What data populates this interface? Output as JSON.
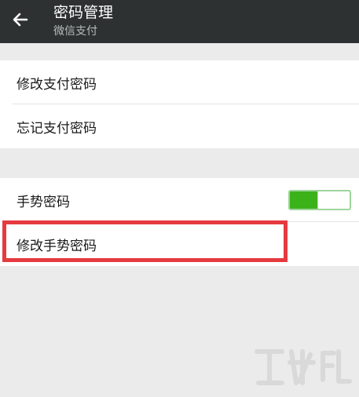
{
  "header": {
    "title": "密码管理",
    "subtitle": "微信支付"
  },
  "pay_group": {
    "items": [
      {
        "label": "修改支付密码"
      },
      {
        "label": "忘记支付密码"
      }
    ]
  },
  "gesture_group": {
    "toggle_label": "手势密码",
    "toggle_on": true,
    "modify_label": "修改手势密码"
  },
  "colors": {
    "appbar": "#2e3132",
    "toggle_on": "#3cb21a",
    "highlight": "#e53a3f"
  }
}
